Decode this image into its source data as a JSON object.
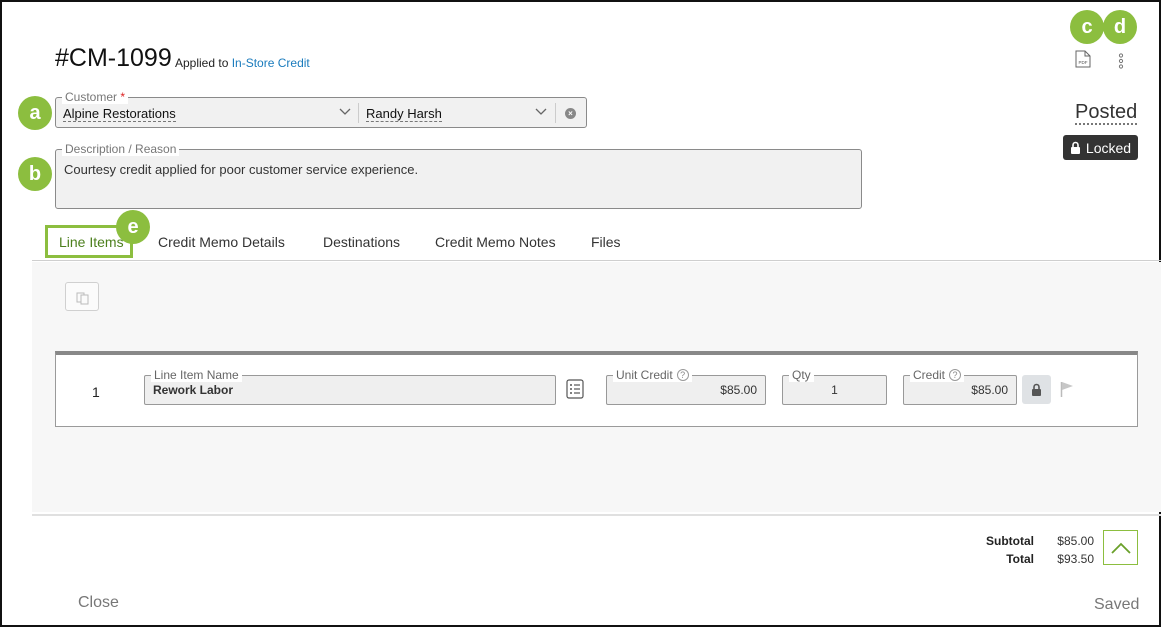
{
  "header": {
    "title": "#CM-1099",
    "applied_prefix": "Applied to",
    "applied_link": "In-Store Credit",
    "status": "Posted",
    "locked_label": "Locked"
  },
  "customer": {
    "label": "Customer",
    "required_mark": "*",
    "company": "Alpine Restorations",
    "contact": "Randy Harsh"
  },
  "description": {
    "label": "Description / Reason",
    "value": "Courtesy credit applied for poor customer service experience."
  },
  "tabs": [
    {
      "label": "Line Items",
      "active": true
    },
    {
      "label": "Credit Memo Details",
      "active": false
    },
    {
      "label": "Destinations",
      "active": false
    },
    {
      "label": "Credit Memo Notes",
      "active": false
    },
    {
      "label": "Files",
      "active": false
    }
  ],
  "line_items": [
    {
      "number": "1",
      "name_label": "Line Item Name",
      "name": "Rework Labor",
      "unit_credit_label": "Unit Credit",
      "unit_credit": "$85.00",
      "qty_label": "Qty",
      "qty": "1",
      "credit_label": "Credit",
      "credit": "$85.00"
    }
  ],
  "totals": {
    "subtotal_label": "Subtotal",
    "subtotal": "$85.00",
    "total_label": "Total",
    "total": "$93.50"
  },
  "footer": {
    "close_label": "Close",
    "saved_label": "Saved"
  },
  "callouts": {
    "a": "a",
    "b": "b",
    "c": "c",
    "d": "d",
    "e": "e"
  },
  "icons": {
    "pdf": "pdf-icon",
    "more": "kebab-menu-icon",
    "lock": "lock-icon",
    "copy": "copy-icon",
    "list": "list-icon",
    "flag": "flag-icon",
    "scroll_top": "chevron-up-icon"
  },
  "colors": {
    "accent_green": "#8cbe3f",
    "link_blue": "#1a7bbd",
    "locked_bg": "#333333"
  }
}
